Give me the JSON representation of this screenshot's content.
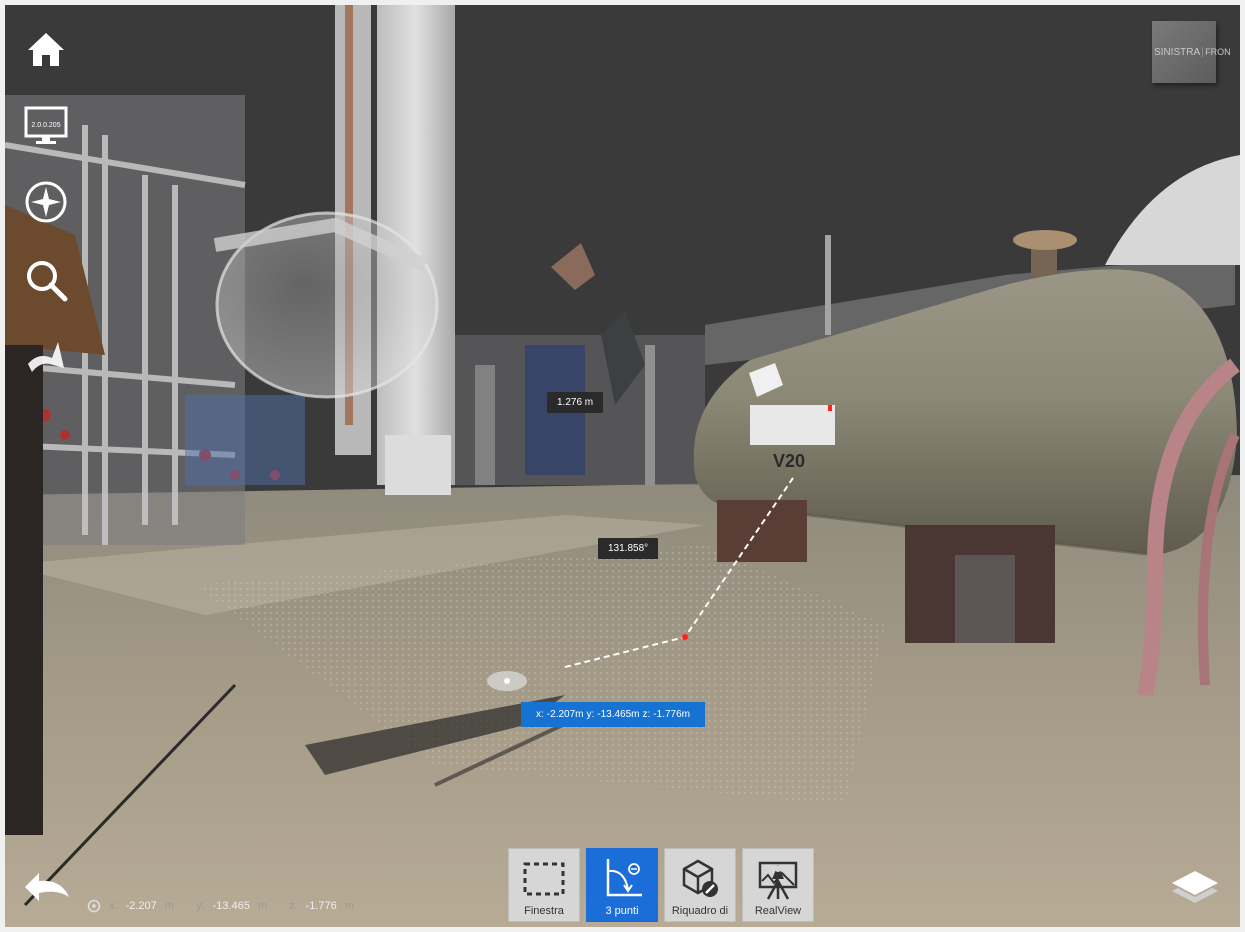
{
  "viewer": {
    "version_label": "2.0.0.205",
    "navcube": {
      "left_face": "SINISTRA",
      "right_face": "FRON"
    }
  },
  "measurement": {
    "distance": "1.276 m",
    "angle": "131.858°",
    "coord_x_label": "x:",
    "coord_x": "-2.207m",
    "coord_y_label": "y:",
    "coord_y": "-13.465m",
    "coord_z_label": "z:",
    "coord_z": "-1.776m"
  },
  "toolbar": {
    "tools": [
      {
        "label": "Finestra",
        "active": false
      },
      {
        "label": "3 punti",
        "active": true
      },
      {
        "label": "Riquadro di",
        "active": false
      },
      {
        "label": "RealView",
        "active": false
      }
    ]
  },
  "status": {
    "x_label": "x:",
    "x_value": "-2.207",
    "x_unit": "m",
    "y_label": "y:",
    "y_value": "-13.465",
    "y_unit": "m",
    "z_label": "z:",
    "z_value": "-1.776",
    "z_unit": "m"
  },
  "colors": {
    "accent": "#1b6dd8",
    "sky": "#3a3a3a",
    "ground": "#a49a88",
    "tank": "#8f8a78"
  },
  "icons": [
    "home-icon",
    "monitor-icon",
    "compass-icon",
    "search-icon",
    "walk-icon",
    "back-arrow-icon",
    "layers-icon"
  ]
}
